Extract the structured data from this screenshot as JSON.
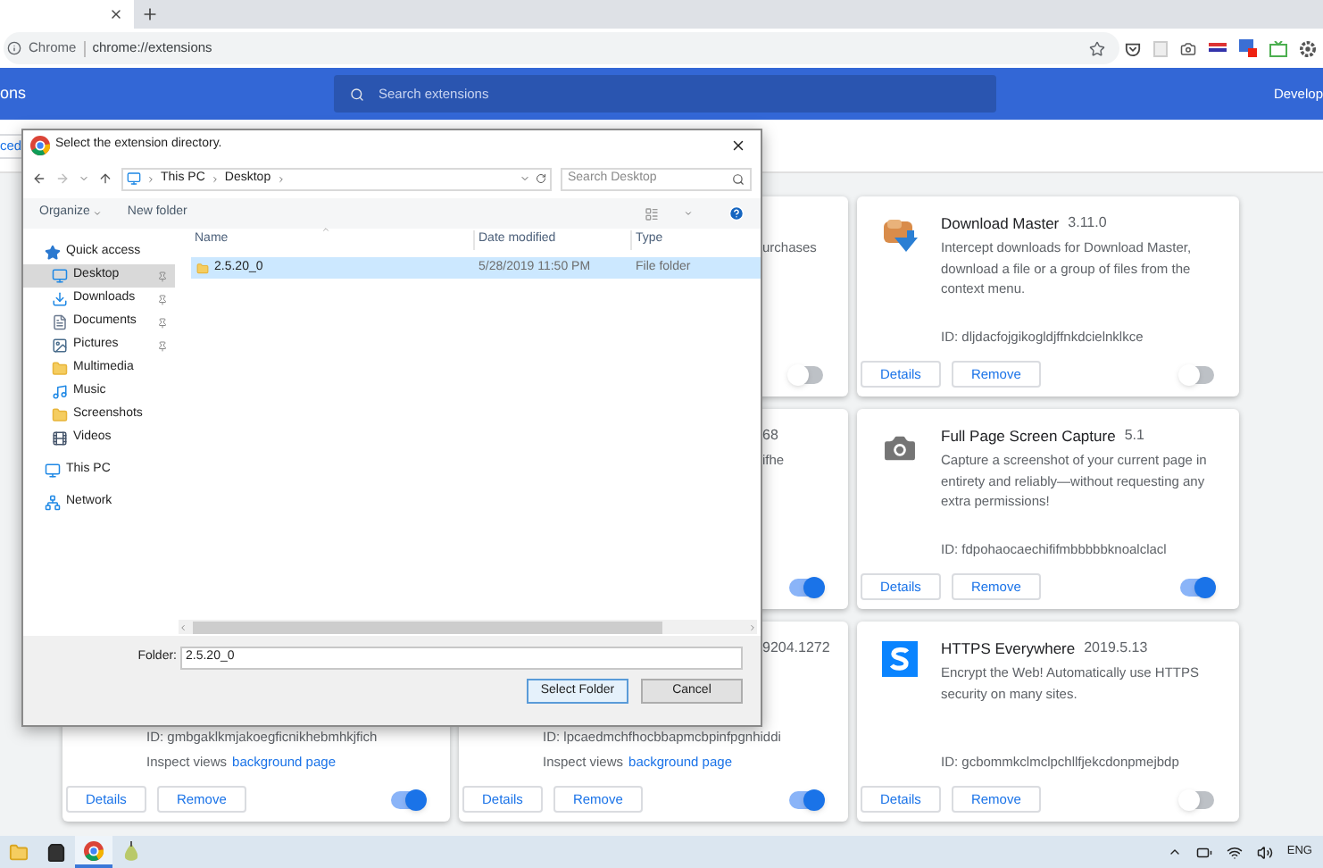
{
  "browser": {
    "site": "Chrome",
    "url": "chrome://extensions"
  },
  "header": {
    "title": "ons",
    "search_placeholder": "Search extensions",
    "developer": "Develop"
  },
  "toolbar": {
    "button": "ced"
  },
  "card_rows": [
    {
      "cards": [
        {
          "description": "urchases",
          "enabled": false
        },
        {
          "kind": "download",
          "name": "Download Master",
          "version": "3.11.0",
          "description": "Intercept downloads for Download Master, download a file or a group of files from the context menu.",
          "id": "ID: dljdacfojgikogldjffnkdcielnklkce",
          "buttons": [
            "Details",
            "Remove"
          ],
          "enabled": false
        }
      ]
    },
    {
      "cards": [
        {
          "version": "68",
          "description": "ifhe",
          "enabled": true
        },
        {
          "kind": "camera",
          "name": "Full Page Screen Capture",
          "version": "5.1",
          "description": "Capture a screenshot of your current page in entirety and reliably—without requesting any extra permissions!",
          "id": "ID: fdpohaocaechififmbbbbbknoalclacl",
          "buttons": [
            "Details",
            "Remove"
          ],
          "enabled": true
        }
      ]
    },
    {
      "cards": [
        {
          "id": "ID: gmbgaklkmjakoegficnikhebmhkjfich",
          "inspect_label": "Inspect views",
          "inspect_link": "background page",
          "buttons": [
            "Details",
            "Remove"
          ],
          "enabled": true
        },
        {
          "version": "9204.1272",
          "id": "ID: lpcaedmchfhocbbapmcbpinfpgnhiddi",
          "inspect_label": "Inspect views",
          "inspect_link": "background page",
          "buttons": [
            "Details",
            "Remove"
          ],
          "enabled": true
        },
        {
          "kind": "shield",
          "name": "HTTPS Everywhere",
          "version": "2019.5.13",
          "description": "Encrypt the Web! Automatically use HTTPS security on many sites.",
          "id": "ID: gcbommkclmclpchllfjekcdonpmejbdp",
          "buttons": [
            "Details",
            "Remove"
          ],
          "enabled": false
        }
      ]
    }
  ],
  "dialog": {
    "title": "Select the extension directory.",
    "path": [
      "This PC",
      "Desktop"
    ],
    "search_placeholder": "Search Desktop",
    "commands": [
      "Organize",
      "New folder"
    ],
    "nav": [
      {
        "label": "Quick access",
        "kind": "star",
        "selected": false,
        "children": [
          {
            "label": "Desktop",
            "kind": "desktop",
            "selected": true,
            "pinned": true
          },
          {
            "label": "Downloads",
            "kind": "download",
            "selected": false,
            "pinned": true
          },
          {
            "label": "Documents",
            "kind": "document",
            "selected": false,
            "pinned": true
          },
          {
            "label": "Pictures",
            "kind": "picture",
            "selected": false,
            "pinned": true
          },
          {
            "label": "Multimedia",
            "kind": "folder",
            "selected": false,
            "pinned": false
          },
          {
            "label": "Music",
            "kind": "music",
            "selected": false,
            "pinned": false
          },
          {
            "label": "Screenshots",
            "kind": "folder",
            "selected": false,
            "pinned": false
          },
          {
            "label": "Videos",
            "kind": "video",
            "selected": false,
            "pinned": false
          }
        ]
      },
      {
        "label": "This PC",
        "kind": "pc",
        "selected": false
      },
      {
        "label": "Network",
        "kind": "network",
        "selected": false
      }
    ],
    "columns": [
      "Name",
      "Date modified",
      "Type"
    ],
    "files": [
      {
        "name": "2.5.20_0",
        "date": "5/28/2019 11:50 PM",
        "type": "File folder",
        "selected": true
      }
    ],
    "folder_label": "Folder:",
    "folder_value": "2.5.20_0",
    "buttons": [
      {
        "label": "Select Folder",
        "kind": "primary"
      },
      {
        "label": "Cancel",
        "kind": "secondary"
      }
    ]
  },
  "taskbar": {
    "apps": [
      {
        "kind": "explorer",
        "selected": false
      },
      {
        "kind": "store",
        "selected": false
      },
      {
        "kind": "chrome",
        "selected": true
      },
      {
        "kind": "tool",
        "selected": false
      }
    ],
    "language": "ENG"
  }
}
